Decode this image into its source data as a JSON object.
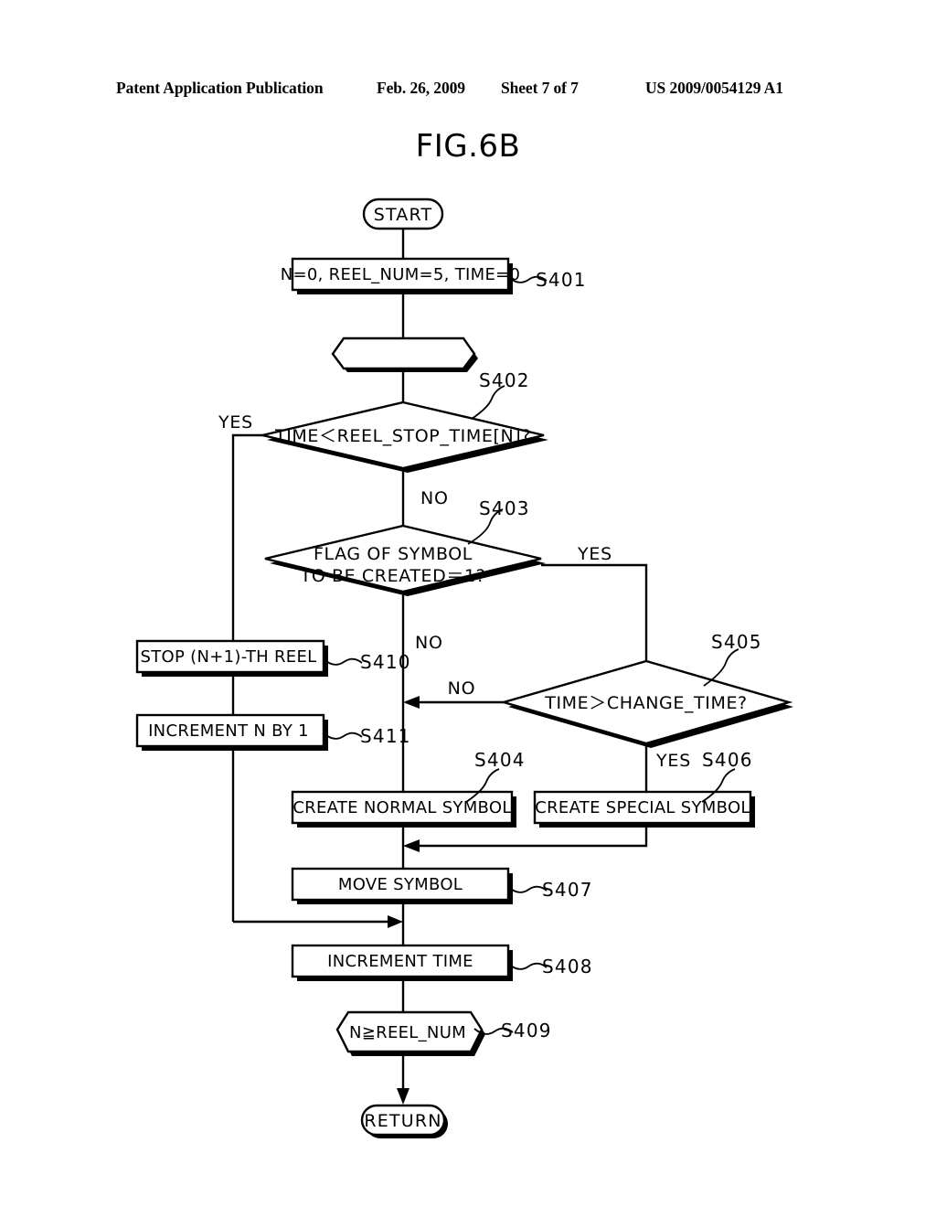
{
  "header": {
    "publication": "Patent Application Publication",
    "date": "Feb. 26, 2009",
    "sheet": "Sheet 7 of 7",
    "number": "US 2009/0054129 A1"
  },
  "figure": {
    "title": "FIG.6B"
  },
  "flowchart": {
    "start_label": "START",
    "return_label": "RETURN",
    "nodes": {
      "s401": {
        "text": "N=0, REEL_NUM=5, TIME=0",
        "step": "S401"
      },
      "loop": {
        "text": "",
        "step": ""
      },
      "s402": {
        "text": "TIME＜REEL_STOP_TIME[N]?",
        "step": "S402"
      },
      "s403": {
        "line1": "FLAG OF SYMBOL",
        "line2": "TO BE CREATED＝1?",
        "step": "S403"
      },
      "s405": {
        "text": "TIME＞CHANGE_TIME?",
        "step": "S405"
      },
      "s410": {
        "text": "STOP (N+1)-TH REEL",
        "step": "S410"
      },
      "s411": {
        "text": "INCREMENT N BY 1",
        "step": "S411"
      },
      "s404": {
        "text": "CREATE NORMAL SYMBOL",
        "step": "S404"
      },
      "s406": {
        "text": "CREATE SPECIAL SYMBOL",
        "step": "S406"
      },
      "s407": {
        "text": "MOVE SYMBOL",
        "step": "S407"
      },
      "s408": {
        "text": "INCREMENT TIME",
        "step": "S408"
      },
      "s409": {
        "text": "N≧REEL_NUM",
        "step": "S409"
      }
    },
    "branches": {
      "s402_yes": "YES",
      "s402_no": "NO",
      "s403_yes": "YES",
      "s403_no": "NO",
      "s405_yes": "YES",
      "s405_no": "NO"
    }
  }
}
